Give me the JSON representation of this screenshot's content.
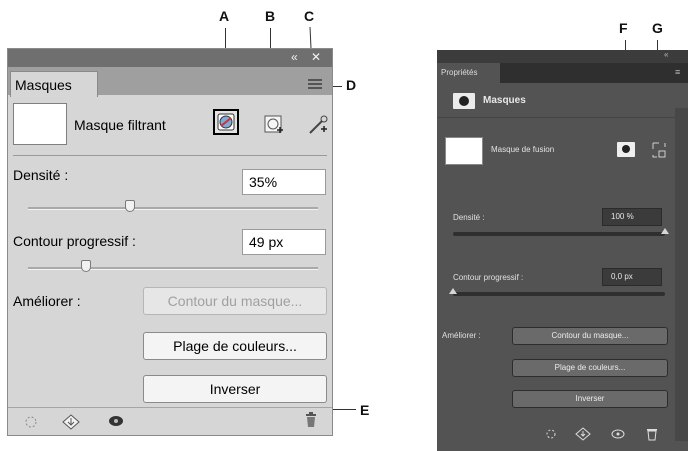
{
  "callouts": {
    "a": "A",
    "b": "B",
    "c": "C",
    "d": "D",
    "e": "E",
    "f": "F",
    "g": "G"
  },
  "left_panel": {
    "tab_label": "Masques",
    "mask_type_label": "Masque filtrant",
    "density": {
      "label": "Densité :",
      "value": "35%",
      "fraction": 0.35
    },
    "feather": {
      "label": "Contour progressif :",
      "value": "49 px",
      "fraction": 0.2
    },
    "refine": {
      "label": "Améliorer :",
      "mask_edge_button": "Contour du masque...",
      "color_range_button": "Plage de couleurs...",
      "invert_button": "Inverser"
    },
    "icons": [
      "collapse-icon",
      "close-icon",
      "panel-menu-icon",
      "pixel-mask-icon",
      "add-vector-mask-icon",
      "refine-mask-icon",
      "load-selection-icon",
      "apply-mask-icon",
      "toggle-visibility-icon",
      "delete-icon"
    ]
  },
  "right_panel": {
    "tab_label": "Propriétés",
    "header_label": "Masques",
    "mask_type_label": "Masque de fusion",
    "density": {
      "label": "Densité :",
      "value": "100 %",
      "fraction": 1.0
    },
    "feather": {
      "label": "Contour progressif :",
      "value": "0,0 px",
      "fraction": 0.0
    },
    "refine": {
      "label": "Améliorer :",
      "mask_edge_button": "Contour du masque...",
      "color_range_button": "Plage de couleurs...",
      "invert_button": "Inverser"
    }
  }
}
